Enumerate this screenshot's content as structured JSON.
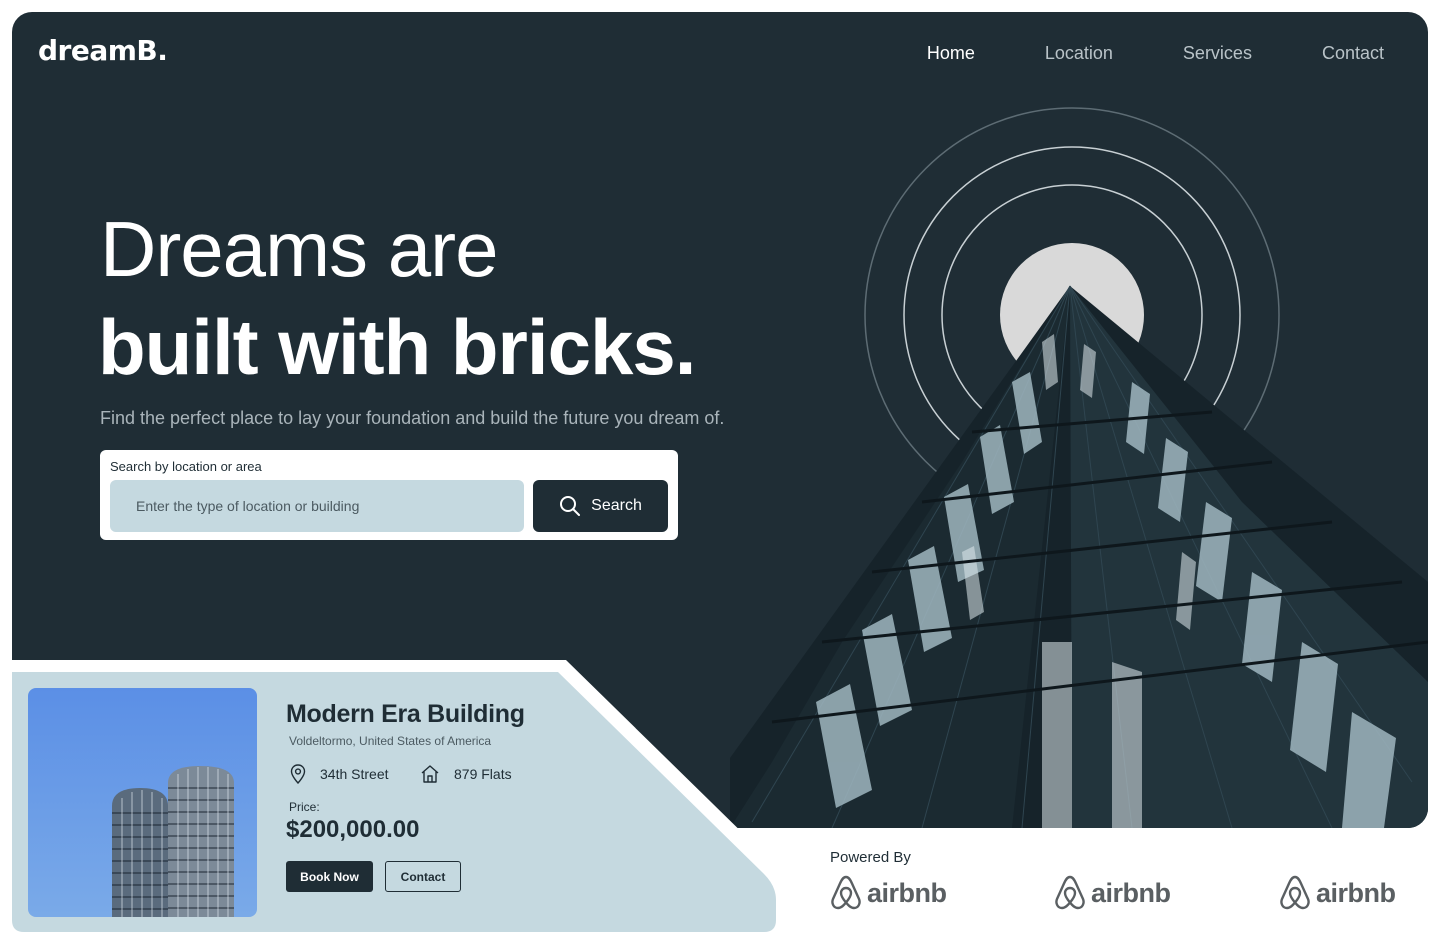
{
  "brand": {
    "logo": "dreamB."
  },
  "nav": {
    "items": [
      "Home",
      "Location",
      "Services",
      "Contact"
    ],
    "active": "Home"
  },
  "hero": {
    "headline_line1": "Dreams are",
    "headline_line2": "built with bricks.",
    "subtitle": "Find the perfect place to lay your foundation and build the future you dream of."
  },
  "search": {
    "label": "Search by location or area",
    "placeholder": "Enter the type of location or building",
    "button_label": "Search",
    "icon": "search-icon"
  },
  "property_card": {
    "title": "Modern Era Building",
    "location": "Voldeltormo, United States of America",
    "street": "34th Street",
    "street_icon": "location-pin-icon",
    "flats": "879 Flats",
    "flats_icon": "house-icon",
    "price_label": "Price:",
    "price": "$200,000.00",
    "book_label": "Book Now",
    "contact_label": "Contact"
  },
  "partners": {
    "heading": "Powered By",
    "logos": [
      "airbnb",
      "airbnb",
      "airbnb"
    ],
    "logo_icon": "airbnb-logo-icon"
  },
  "colors": {
    "hero_bg": "#1f2d35",
    "card_bg": "#c5d9e0",
    "accent_dark": "#1f2d35",
    "text_muted": "#a9b4ba"
  }
}
